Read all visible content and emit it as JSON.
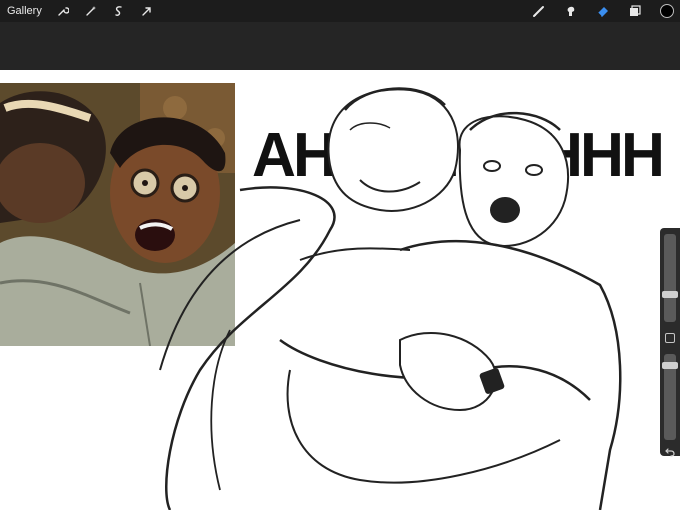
{
  "app": {
    "gallery_label": "Gallery"
  },
  "toolbar_left": [
    "wrench-icon",
    "magic-wand-icon",
    "selection-icon",
    "transform-arrow-icon"
  ],
  "toolbar_right": [
    "brush-icon",
    "smudge-icon",
    "eraser-icon",
    "layers-icon",
    "color-picker-icon"
  ],
  "colors": {
    "topbar": "#1c1c1c",
    "eraser_active": "#3a8ef0",
    "current_color": "#000000"
  },
  "canvas": {
    "lettering": "AHHHHHHHHH"
  },
  "brush_slider": {
    "size_level": 0.3,
    "opacity_level": 0.9
  }
}
